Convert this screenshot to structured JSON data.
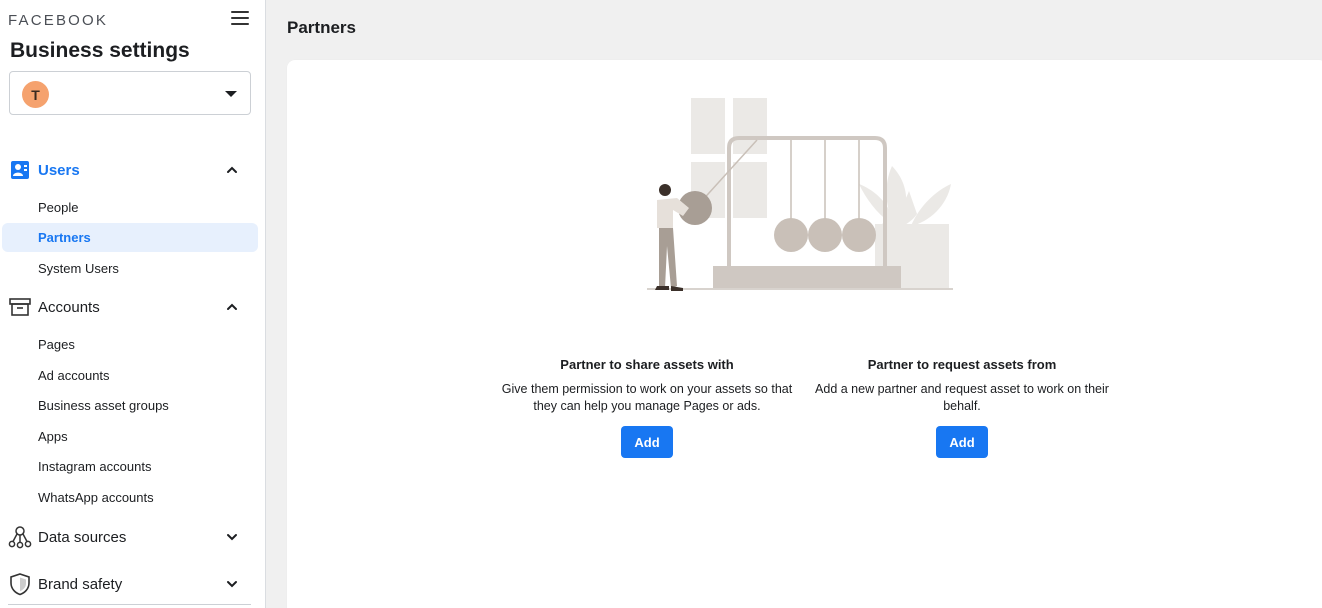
{
  "sidebar": {
    "brand": "FACEBOOK",
    "title": "Business settings",
    "account_avatar_letter": "T",
    "sections": {
      "users": {
        "label": "Users",
        "items": [
          "People",
          "Partners",
          "System Users"
        ]
      },
      "accounts": {
        "label": "Accounts",
        "items": [
          "Pages",
          "Ad accounts",
          "Business asset groups",
          "Apps",
          "Instagram accounts",
          "WhatsApp accounts"
        ]
      },
      "data_sources": {
        "label": "Data sources"
      },
      "brand_safety": {
        "label": "Brand safety"
      }
    },
    "selected_item": "Partners"
  },
  "main": {
    "page_title": "Partners",
    "options": [
      {
        "title": "Partner to share assets with",
        "description": "Give them permission to work on your assets so that they can help you manage Pages or ads.",
        "button_label": "Add"
      },
      {
        "title": "Partner to request assets from",
        "description": "Add a new partner and request asset to work on their behalf.",
        "button_label": "Add"
      }
    ]
  },
  "colors": {
    "accent": "#1877f2",
    "selected_bg": "#e7f0fd",
    "avatar": "#f5a26e",
    "illustration": "#c9c0b8"
  }
}
